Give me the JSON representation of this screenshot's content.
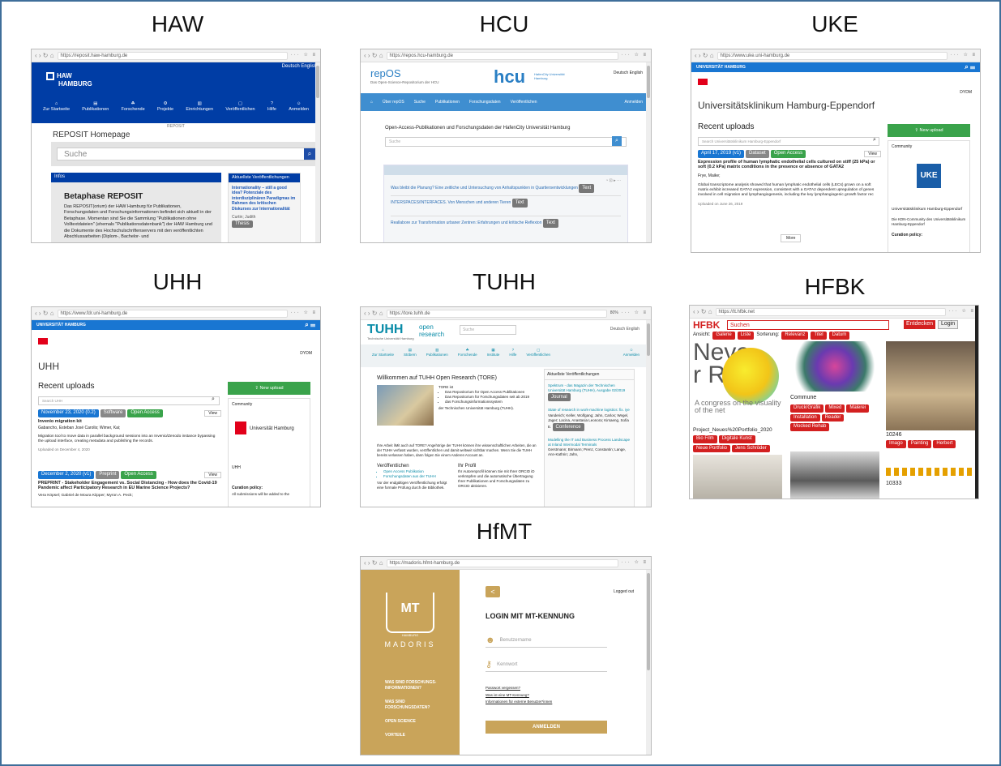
{
  "labels": {
    "haw": "HAW",
    "hcu": "HCU",
    "uke": "UKE",
    "uhh": "UHH",
    "tuhh": "TUHH",
    "hfbk": "HFBK",
    "hfmt": "HfMT"
  },
  "haw": {
    "url": "https://reposit.haw-hamburg.de",
    "lang": "Deutsch English",
    "logo_line1": "HAW",
    "logo_line2": "HAMBURG",
    "nav": [
      "Zur Startseite",
      "Publikationen",
      "Forschende",
      "Projekte",
      "Einrichtungen",
      "Veröffentlichen",
      "Hilfe",
      "Anmelden"
    ],
    "subnav": "REPOSIT",
    "title": "REPOSIT Homepage",
    "search_placeholder": "Suche",
    "info_header": "Infos",
    "news_header": "Aktuellste Veröffentlichungen",
    "beta_title": "Betaphase REPOSIT",
    "beta_text": "Das REPOSIT(orium) der HAW Hamburg für Publikationen, Forschungsdaten und Forschungsinformationen befindet sich aktuell in der Betaphase. Momentan sind Sie die Sammlung \"Publikationen ohne Volltextdateien\" (ehemals \"Publikationsdatenbank\") der HAW Hamburg und die Dokumente des Hochschulschriftenservers mit den veröffentlichten Abschlussarbeiten (Diplom-, Bachelor- und",
    "news_item": "Internationality – still a good idea? Potenziale des interdisziplinären Paradigmas im Rahmen des kritischen Diskurses zur Internationalität",
    "news_meta": "Curtin; Judith",
    "news_badge": "Thesis"
  },
  "hcu": {
    "url": "https://repos.hcu-hamburg.de",
    "brand": "repOS",
    "tagline": "Das Open-Science-Repositorium der HCU",
    "logo": "hcu",
    "logo_sub": "HafenCity Universität Hamburg",
    "lang": "Deutsch English",
    "nav": [
      "Über repOS",
      "Suche",
      "Publikationen",
      "Forschungsdaten",
      "Veröffentlichen"
    ],
    "login": "Anmelden",
    "intro": "Open-Access-Publikationen und Forschungsdaten der HafenCity Universität Hamburg",
    "search_placeholder": "Suche",
    "items": [
      {
        "title": "Was bleibt die Planung? Eine zeitliche und Untersuchung von Anhaltspunkten in Quartiersentwicklungen",
        "badge": "Text"
      },
      {
        "title": "INTERSPACES/INTERFACES. Von Menschen und anderen Tieren",
        "badge": "Text"
      },
      {
        "title": "Reallabore zur Transformation urbaner Zentren: Erfahrungen und kritische Reflexion",
        "badge": "Text"
      }
    ]
  },
  "uke": {
    "url": "https://www.uke.uni-hamburg.de",
    "bar": "UNIVERSITÄT HAMBURG",
    "lang": "DYDM",
    "inst": "Universitätsklinikum Hamburg-Eppendorf",
    "recent": "Recent uploads",
    "search_placeholder": "Search Universitätsklinikum Hamburg-Eppendorf",
    "new_upload": "New upload",
    "community": "Community",
    "date": "April 17, 2019 (v1)",
    "type": "Dataset",
    "access": "Open Access",
    "view": "View",
    "item_title": "Expression profile of human lymphatic endothelial cells cultured on stiff (25 kPa) or soft (0.2 kPa) matrix conditions in the presence or absence of GATA2",
    "author": "Frye, Maike;",
    "abstract": "Global transcriptome analysis showed that human lymphatic endothelial cells (LECs) grown on a soft matrix exhibit increased GATA2 expression, consistent with a GATA2 dependent upregulation of genes involved in cell migration and lymphangiogenesis, including the key lymphangiogenic growth factor rec",
    "uploaded": "Uploaded on June 26, 2019",
    "more": "More",
    "logo": "UKE",
    "side1": "Universitätsklinikum Hamburg-Eppendorf",
    "side2": "Die KDN-Community des Universitätsklinikum Hamburg-Eppendorf",
    "policy": "Curation policy:"
  },
  "uhh": {
    "url": "https://www.fdr.uni-hamburg.de",
    "bar": "UNIVERSITÄT HAMBURG",
    "lang": "DYDM",
    "title": "UHH",
    "recent": "Recent uploads",
    "search_placeholder": "Search UHH",
    "new_upload": "New upload",
    "community": "Community",
    "logo_text": "Universität Hamburg",
    "items": [
      {
        "date": "November 23, 2020 (0.2)",
        "type": "Software",
        "access": "Open Access",
        "view": "View",
        "title": "Invenio migration kit",
        "authors": "Gabancho, Esteban José Carolis;  Wimer, Kai;",
        "text": "Migration tool to move data in parallel background sessions into an Invenio/Zenodo instance bypassing the upload interface, creating metadata and publishing the records.",
        "uploaded": "Uploaded on December 4, 2020"
      },
      {
        "date": "December 2, 2020 (v1)",
        "type": "Preprint",
        "access": "Open Access",
        "view": "View",
        "title": "PREPRINT - Stakeholder Engagement vs. Social Distancing - How does the Covid-19 Pandemic affect Participatory Research in EU Marine Science Projects?",
        "authors": "Vera Köpsel;  Gabriel de Moura Kiipper;  Myron A. Peck;"
      }
    ],
    "side_name": "UHH",
    "policy": "Curation policy:",
    "policy_text": "All submissions will be added to the"
  },
  "tuhh": {
    "url": "https://tore.tuhh.de",
    "zoom": "80%",
    "logo": "TUHH",
    "logo_sub": "Technische Universität Hamburg",
    "open": "open",
    "research": "research",
    "search_placeholder": "Suche",
    "lang": "Deutsch English",
    "nav": [
      "Zur Startseite",
      "Stöbern",
      "Publikationen",
      "Forschende",
      "Institute",
      "Hilfe",
      "Veröffentlichen",
      "Anmelden"
    ],
    "welcome": "Willkommen auf TUHH Open Research (TORE)",
    "tore_list": [
      "Das Repositorium für Open Access Publikationen",
      "Das Repositorium für Forschungsdaten seit ab 2019",
      "das Forschungsinformationssystem"
    ],
    "tore_is": "TORE ist",
    "tore_end": "der Technischen Universität Hamburg (TUHH).",
    "para": "Ihre Arbeit liMit auch auf TORE? Angehörige der TUHH können ihre wissenschaftlichen Arbeiten, die an der TUHH verfasst wurden, veröffentlichen und damit weltweit sichtbar machen. Wenn Sie die TUHH bereits verlassen haben, dann folgen Sie einem Anderen Account an.",
    "pub_h": "Veröffentlichen",
    "pub_items": [
      "Open Access Publikation",
      "Forschungsdaten aus der TUHH"
    ],
    "pub_text": "Vor der endgültigen Veröffentlichung erfolgt eine formale Prüfung durch die Bibliothek.",
    "orcid_h": "Ihr Profil",
    "orcid_text": "Ihr Autorenprofil können Sie mit Ihrer ORCID iD verknüpfen und die automatische Übertragung Ihrer Publikationen und Forschungsdaten zu ORCID aktivieren.",
    "news_h": "Aktuellste Veröffentlichungen",
    "news": [
      {
        "title": "Spektrum - das Magazin der Technischen Universität Hamburg (TUHH), Ausgabe 02/2019",
        "badge": "Journal"
      },
      {
        "title": "State of research in work-machine logistics: fix. iye",
        "meta": "Vanderich; Keller, Wolfgang; Jahn, Carlos; Wegel, Jager; Lacina, Anastasia Leonora; Kirsaeng, Sofia E.",
        "badge": "Conference"
      },
      {
        "title": "Modelling the IT and Business Process Landscape at Inland Intermodal Terminals",
        "meta": "Gerstmann; Birmann; Prenz, Constantin; Lange, Ann-Kathrin; Jahn,"
      }
    ]
  },
  "hfbk": {
    "url": "https://tt.hfbk.net",
    "logo": "HFBK",
    "search_value": "Suchen",
    "discover": "Entdecken",
    "login": "Login",
    "view": "Ansicht:",
    "sort": "Sorterung:",
    "view_opts": [
      "Galerie",
      "Liste"
    ],
    "sort_opts": [
      "Relevanz",
      "Titel",
      "Datum"
    ],
    "big_text": "Never Rea",
    "caption1": "A congress on the visuality of the net",
    "caption2": "Project_Neues%20Portfolio_2020",
    "commune": "Commune",
    "commune_tags": [
      "Druck/Grafik",
      "Mixed",
      "Malerei",
      "Installation",
      "Reader",
      "Mocked Rehab"
    ],
    "tags2": [
      "Bio Film",
      "Digitale Kunst",
      "Neue Portfolio",
      "Jens Schröder"
    ],
    "no10246": "10246",
    "no10333": "10333",
    "tags3": [
      "Imago",
      "Painting",
      "Herbert"
    ]
  },
  "hfmt": {
    "url": "https://madoris.hfmt-hamburg.de",
    "brand": "MADORIS",
    "logo_sub": "HAMBURG",
    "menu": [
      "WAS SIND FORSCHUNGS-INFORMATIONEN?",
      "WAS SIND FORSCHUNGSDATEN?",
      "OPEN SCIENCE",
      "VORTEILE"
    ],
    "back": "<",
    "logged_out": "Logged out",
    "heading": "LOGIN MIT MT-KENNUNG",
    "user_placeholder": "Benutzername",
    "pass_placeholder": "Kennwort",
    "links": [
      "Passwort vergessen?",
      "Was ist eine MT-Kennung?",
      "Informationen für externe Benutzer*innen"
    ],
    "submit": "ANMELDEN"
  },
  "colors": {
    "frame": "#3f6e9a",
    "haw_blue": "#003da5",
    "hcu_blue": "#3f8ed0",
    "uni_blue": "#1976d2",
    "green": "#3aa34b",
    "hfbk_red": "#d32020",
    "madoris": "#c9a45a"
  }
}
